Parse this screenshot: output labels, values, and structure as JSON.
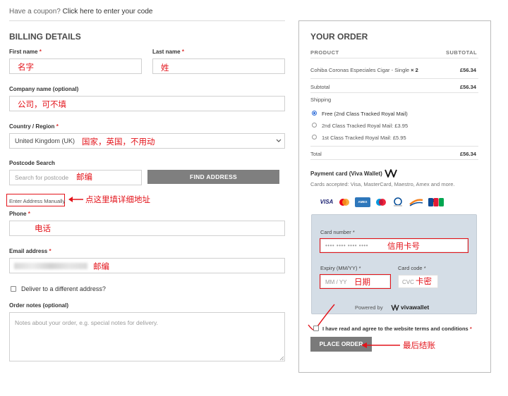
{
  "coupon": {
    "prefix": "Have a coupon?",
    "link": "Click here to enter your code"
  },
  "billing": {
    "title": "BILLING DETAILS",
    "first_name": {
      "label": "First name",
      "note": "名字"
    },
    "last_name": {
      "label": "Last name",
      "note": "姓"
    },
    "company": {
      "label": "Company name (optional)",
      "note": "公司，可不填"
    },
    "country": {
      "label": "Country / Region",
      "value": "United Kingdom (UK)",
      "note": "国家，英国，不用动"
    },
    "postcode": {
      "label": "Postcode Search",
      "placeholder": "Search for postcode",
      "note": "邮编",
      "button": "FIND ADDRESS"
    },
    "manual": {
      "link": "Enter Address Manually",
      "note": "点这里填详细地址"
    },
    "phone": {
      "label": "Phone",
      "note": "电话"
    },
    "email": {
      "label": "Email address",
      "note": "邮编"
    },
    "deliver_different": "Deliver to a different address?",
    "notes": {
      "label": "Order notes (optional)",
      "placeholder": "Notes about your order, e.g. special notes for delivery."
    }
  },
  "order": {
    "title": "YOUR ORDER",
    "col_product": "PRODUCT",
    "col_subtotal": "SUBTOTAL",
    "item_name": "Cohiba Coronas Especiales Cigar - Single",
    "item_qty": "× 2",
    "item_price": "£56.34",
    "subtotal_label": "Subtotal",
    "subtotal_value": "£56.34",
    "shipping_label": "Shipping",
    "shipping_options": [
      {
        "label": "Free (2nd Class Tracked Royal Mail)",
        "selected": true
      },
      {
        "label": "2nd Class Tracked Royal Mail: £3.95",
        "selected": false
      },
      {
        "label": "1st Class Tracked Royal Mail: £5.95",
        "selected": false
      }
    ],
    "total_label": "Total",
    "total_value": "£56.34",
    "payment_title": "Payment card (Viva Wallet)",
    "cards_accepted": "Cards accepted: Visa, MasterCard, Maestro, Amex and more.",
    "card_logos": [
      "VISA",
      "MC",
      "AMEX",
      "MAE",
      "DC",
      "DSC",
      "BC",
      "JCB"
    ],
    "card_number": {
      "label": "Card number",
      "placeholder": "•••• •••• •••• ••••",
      "note": "信用卡号"
    },
    "expiry": {
      "label": "Expiry (MM/YY)",
      "placeholder": "MM / YY",
      "note": "日期"
    },
    "cvc": {
      "label": "Card code",
      "placeholder": "CVC",
      "note": "卡密"
    },
    "powered_by": "Powered by",
    "brand": "vivawallet",
    "terms_prefix": "I have read and agree to the website",
    "terms_link": "terms and conditions",
    "place_order": "PLACE ORDER",
    "place_order_note": "最后结账"
  },
  "colors": {
    "annotation_red": "#e3141b",
    "button_gray": "#7f7f7f",
    "panel_blue": "#d4dde6"
  }
}
